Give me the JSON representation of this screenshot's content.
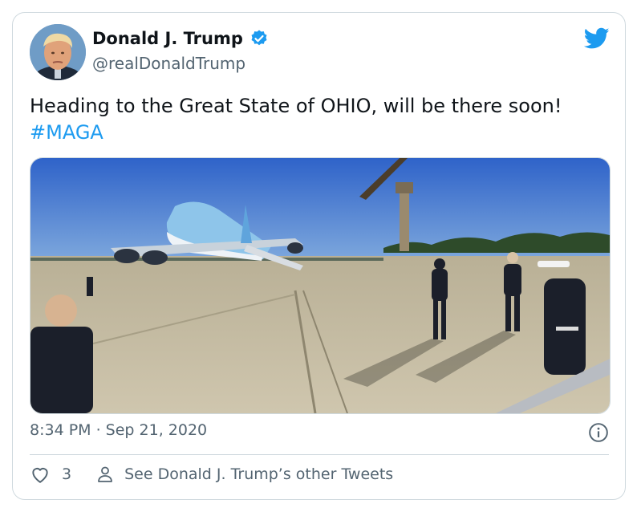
{
  "author": {
    "display_name": "Donald J. Trump",
    "handle": "@realDonaldTrump",
    "verified": true
  },
  "tweet": {
    "text": "Heading to the Great State of OHIO, will be there soon!",
    "hashtag": "#MAGA",
    "timestamp": "8:34 PM · Sep 21, 2020"
  },
  "footer": {
    "like_count": "3",
    "other_tweets_label": "See Donald J. Trump’s other Tweets"
  },
  "icons": {
    "brand": "twitter-bird-icon",
    "verified": "verified-badge-icon",
    "info": "info-icon",
    "like": "heart-icon",
    "profile": "person-icon"
  },
  "colors": {
    "brand": "#1d9bf0",
    "text": "#0f1419",
    "muted": "#536471",
    "border": "#cfd9de"
  }
}
